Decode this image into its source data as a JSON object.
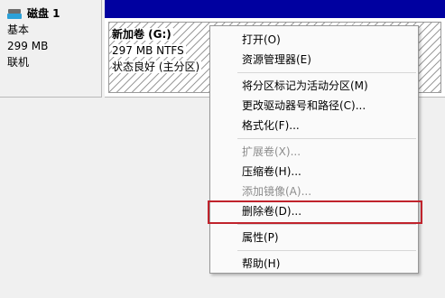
{
  "disk": {
    "icon": "disk-drive-icon",
    "title": "磁盘 1",
    "type": "基本",
    "size": "299 MB",
    "status": "联机"
  },
  "volume": {
    "header_color": "#0000a0",
    "name": "新加卷  (G:)",
    "size_fs": "297 MB NTFS",
    "status": "状态良好 (主分区)"
  },
  "menu": {
    "open": "打开(O)",
    "explorer": "资源管理器(E)",
    "mark_active": "将分区标记为活动分区(M)",
    "change_letter": "更改驱动器号和路径(C)...",
    "format": "格式化(F)...",
    "extend": "扩展卷(X)...",
    "shrink": "压缩卷(H)...",
    "add_mirror": "添加镜像(A)...",
    "delete": "删除卷(D)...",
    "properties": "属性(P)",
    "help": "帮助(H)"
  },
  "colors": {
    "highlight_border": "#c0232c",
    "disabled_text": "#8d8d8d"
  }
}
